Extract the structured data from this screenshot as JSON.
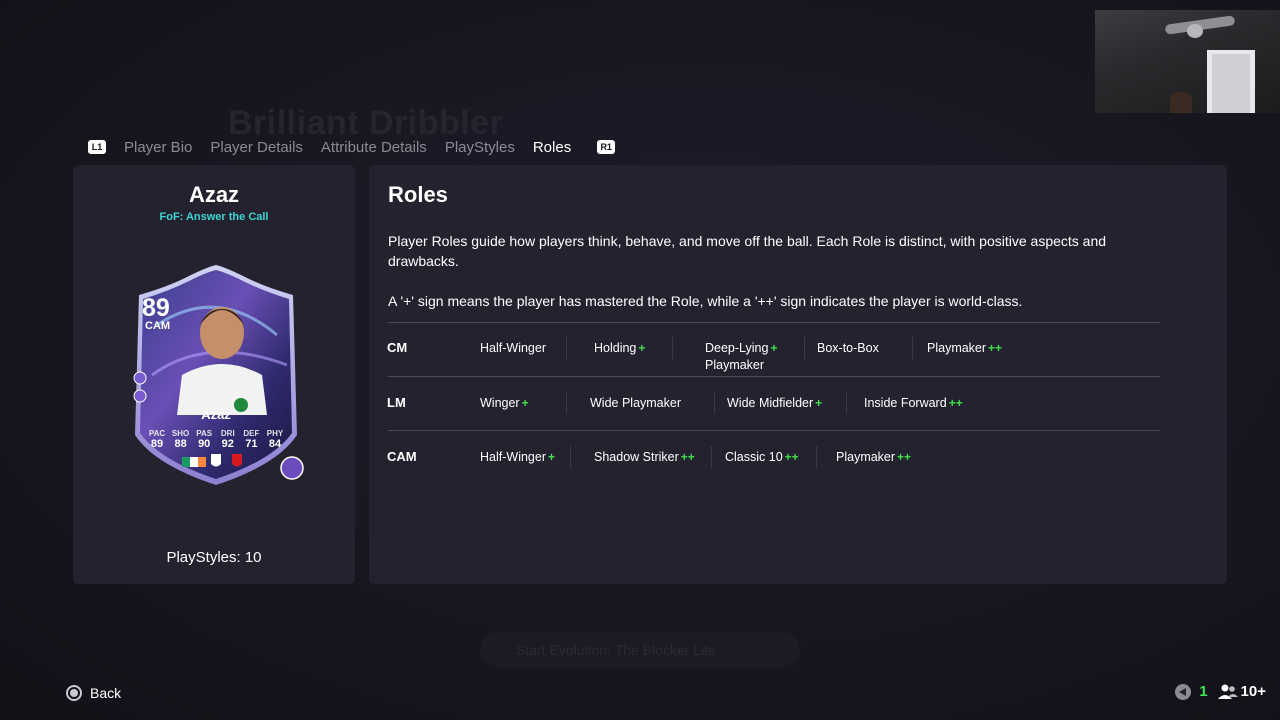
{
  "background_ghost": {
    "title": "Brilliant Dribbler",
    "bottom_hint": "Start Evolution: The Blocker Lite"
  },
  "tabs": {
    "left_button": "L1",
    "right_button": "R1",
    "items": [
      {
        "label": "Player Bio",
        "active": false
      },
      {
        "label": "Player Details",
        "active": false
      },
      {
        "label": "Attribute Details",
        "active": false
      },
      {
        "label": "PlayStyles",
        "active": false
      },
      {
        "label": "Roles",
        "active": true
      }
    ]
  },
  "player": {
    "name": "Azaz",
    "version": "FoF: Answer the Call",
    "playstyles_label": "PlayStyles: 10",
    "card": {
      "rating": "89",
      "position": "CAM",
      "name": "Azaz",
      "stats": [
        {
          "label": "PAC",
          "value": "89"
        },
        {
          "label": "SHO",
          "value": "88"
        },
        {
          "label": "PAS",
          "value": "90"
        },
        {
          "label": "DRI",
          "value": "92"
        },
        {
          "label": "DEF",
          "value": "71"
        },
        {
          "label": "PHY",
          "value": "84"
        }
      ]
    }
  },
  "roles": {
    "title": "Roles",
    "description1": "Player Roles guide how players think, behave, and move off the ball. Each Role is distinct, with positive aspects and drawbacks.",
    "description2": "A '+' sign means the player has mastered the Role, while a '++' sign indicates the player is world-class.",
    "rows": [
      {
        "position": "CM",
        "roles": [
          {
            "name": "Half-Winger",
            "plus": ""
          },
          {
            "name": "Holding",
            "plus": "+"
          },
          {
            "name": "Deep-Lying",
            "name2": "Playmaker",
            "plus": "+"
          },
          {
            "name": "Box-to-Box",
            "plus": ""
          },
          {
            "name": "Playmaker",
            "plus": "++"
          }
        ]
      },
      {
        "position": "LM",
        "roles": [
          {
            "name": "Winger",
            "plus": "+"
          },
          {
            "name": "Wide Playmaker",
            "plus": ""
          },
          {
            "name": "Wide Midfielder",
            "plus": "+"
          },
          {
            "name": "Inside Forward",
            "plus": "++"
          }
        ]
      },
      {
        "position": "CAM",
        "roles": [
          {
            "name": "Half-Winger",
            "plus": "+"
          },
          {
            "name": "Shadow Striker",
            "plus": "++"
          },
          {
            "name": "Classic 10",
            "plus": "++"
          },
          {
            "name": "Playmaker",
            "plus": "++"
          }
        ]
      }
    ]
  },
  "footer": {
    "back_label": "Back",
    "notification_count": "1",
    "friends_count": "10+"
  },
  "colors": {
    "accent_green": "#3fe04f",
    "version_teal": "#3ed6d2",
    "panel_bg": "#23222e"
  }
}
